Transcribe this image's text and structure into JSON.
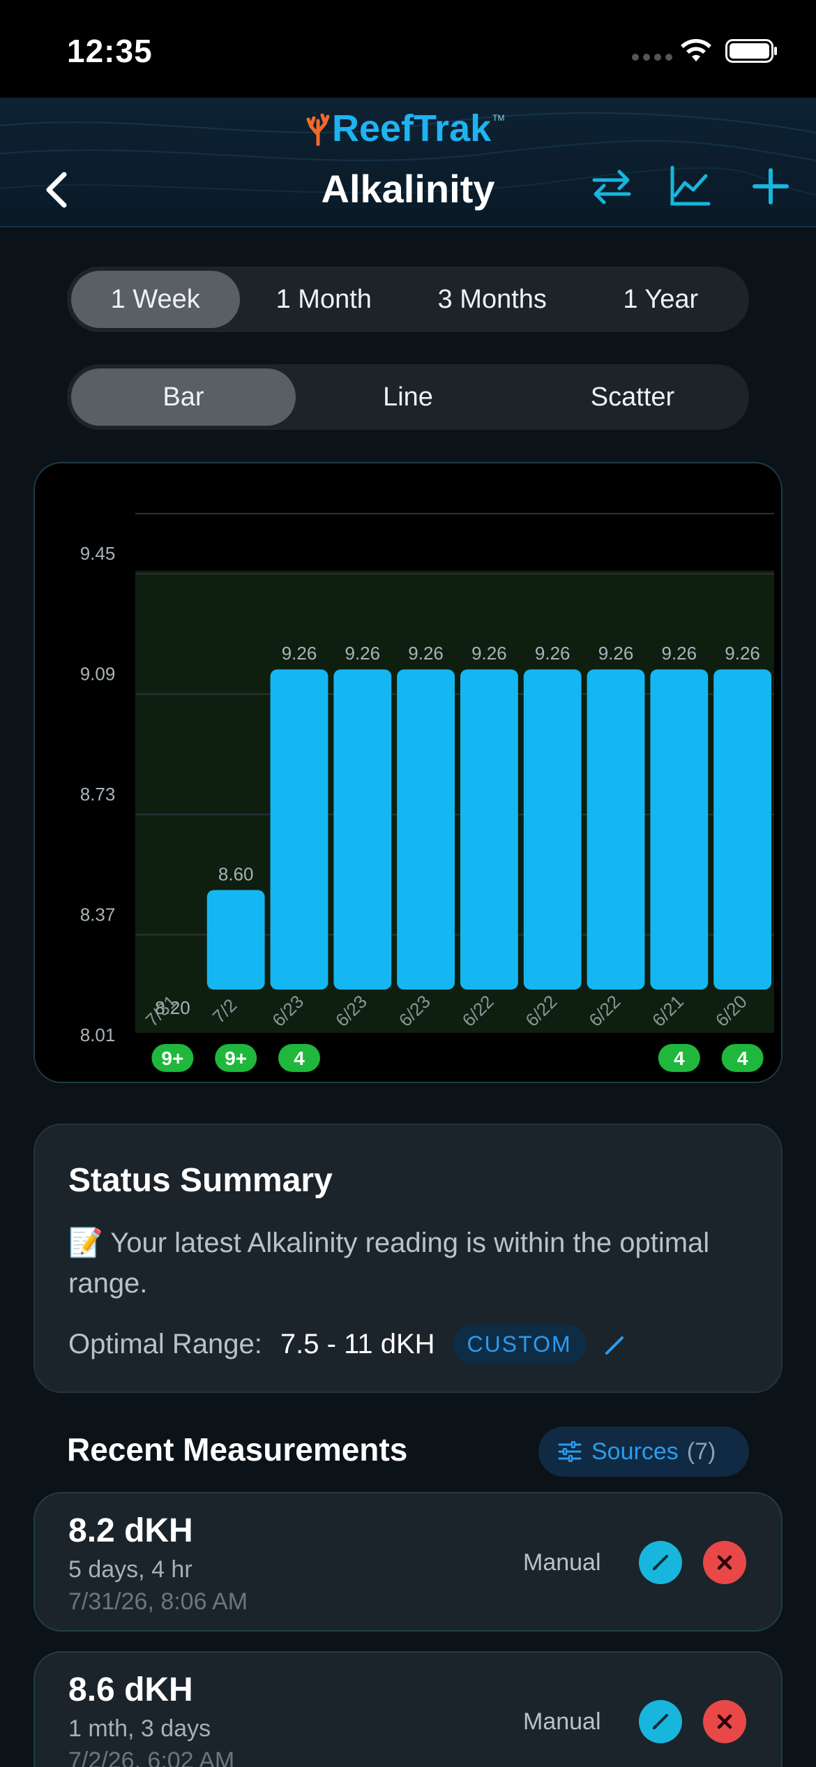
{
  "status_bar": {
    "time": "12:35"
  },
  "header": {
    "brand": "ReefTrak",
    "trademark": "TM",
    "title": "Alkalinity",
    "icons": [
      "back-chevron-icon",
      "swap-arrows-icon",
      "line-chart-icon",
      "plus-icon"
    ],
    "accent": "#1fb3f2"
  },
  "range_tabs": [
    {
      "label": "1 Week",
      "active": true
    },
    {
      "label": "1 Month",
      "active": false
    },
    {
      "label": "3 Months",
      "active": false
    },
    {
      "label": "1 Year",
      "active": false
    }
  ],
  "chart_type_tabs": [
    {
      "label": "Bar",
      "active": true
    },
    {
      "label": "Line",
      "active": false
    },
    {
      "label": "Scatter",
      "active": false
    }
  ],
  "chart_data": {
    "type": "bar",
    "categories": [
      "7/31",
      "7/2",
      "6/23",
      "6/23",
      "6/23",
      "6/22",
      "6/22",
      "6/22",
      "6/21",
      "6/20"
    ],
    "values": [
      8.2,
      8.6,
      9.26,
      9.26,
      9.26,
      9.26,
      9.26,
      9.26,
      9.26,
      9.26
    ],
    "value_labels": [
      "8.20",
      "8.60",
      "9.26",
      "9.26",
      "9.26",
      "9.26",
      "9.26",
      "9.26",
      "9.26",
      "9.26"
    ],
    "y_tick_labels": [
      "9.45",
      "9.09",
      "8.73",
      "8.37",
      "8.01"
    ],
    "y_ticks": [
      9.45,
      9.09,
      8.73,
      8.37,
      8.01
    ],
    "ylim": [
      8.01,
      9.63
    ],
    "optimal_band": [
      8.0,
      9.46
    ],
    "count_badges": [
      "9+",
      "9+",
      "4",
      "",
      "",
      "",
      "",
      "",
      "4",
      "4"
    ],
    "bar_color": "#15b7f2",
    "band_color": "#0f1f0f",
    "badge_color": "#1fb83c",
    "grid": true,
    "title": "",
    "xlabel": "",
    "ylabel": ""
  },
  "status_summary": {
    "title": "Status Summary",
    "emoji": "📝",
    "message": "Your latest Alkalinity reading is within the optimal range.",
    "range_label": "Optimal Range:",
    "range_value": "7.5 - 11 dKH",
    "badge": "CUSTOM"
  },
  "recent": {
    "title": "Recent Measurements",
    "sources_label": "Sources",
    "sources_count": "(7)",
    "items": [
      {
        "value": "8.2 dKH",
        "ago": "5 days, 4 hr",
        "date": "7/31/26, 8:06 AM",
        "source": "Manual"
      },
      {
        "value": "8.6 dKH",
        "ago": "1 mth, 3 days",
        "date": "7/2/26, 6:02 AM",
        "source": "Manual"
      }
    ]
  }
}
